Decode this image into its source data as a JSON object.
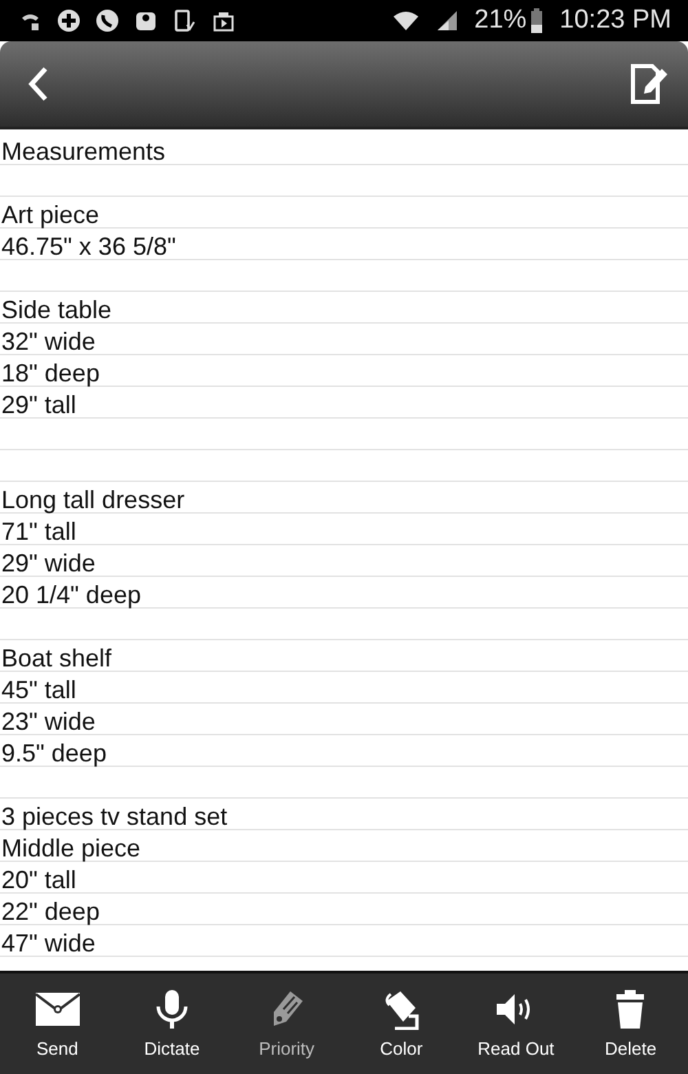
{
  "status_bar": {
    "battery": "21%",
    "time": "10:23 PM"
  },
  "note": {
    "lines": [
      {
        "kind": "text",
        "text": "Measurements"
      },
      {
        "kind": "blank"
      },
      {
        "kind": "text",
        "text": "Art piece"
      },
      {
        "kind": "text",
        "text": "46.75\" x 36 5/8\""
      },
      {
        "kind": "blank"
      },
      {
        "kind": "text",
        "text": "Side table"
      },
      {
        "kind": "text",
        "text": "32\" wide"
      },
      {
        "kind": "text",
        "text": "18\" deep"
      },
      {
        "kind": "text",
        "text": "29\" tall"
      },
      {
        "kind": "blank"
      },
      {
        "kind": "blank"
      },
      {
        "kind": "text",
        "text": "Long tall dresser"
      },
      {
        "kind": "text",
        "text": "71\" tall"
      },
      {
        "kind": "text",
        "text": "29\" wide"
      },
      {
        "kind": "text",
        "text": "20 1/4\" deep"
      },
      {
        "kind": "blank"
      },
      {
        "kind": "text",
        "text": "Boat shelf"
      },
      {
        "kind": "text",
        "text": "45\" tall"
      },
      {
        "kind": "text",
        "text": "23\" wide"
      },
      {
        "kind": "text",
        "text": "9.5\" deep"
      },
      {
        "kind": "blank"
      },
      {
        "kind": "text",
        "text": "3 pieces tv stand set"
      },
      {
        "kind": "text",
        "text": "Middle piece"
      },
      {
        "kind": "text",
        "text": "20\" tall"
      },
      {
        "kind": "text",
        "text": "22\" deep"
      },
      {
        "kind": "text",
        "text": "47\" wide"
      }
    ]
  },
  "toolbar": [
    {
      "kind": "send",
      "label": "Send",
      "disabled": false
    },
    {
      "kind": "dictate",
      "label": "Dictate",
      "disabled": false
    },
    {
      "kind": "priority",
      "label": "Priority",
      "disabled": true
    },
    {
      "kind": "color",
      "label": "Color",
      "disabled": false
    },
    {
      "kind": "readout",
      "label": "Read Out",
      "disabled": false
    },
    {
      "kind": "delete",
      "label": "Delete",
      "disabled": false
    }
  ]
}
